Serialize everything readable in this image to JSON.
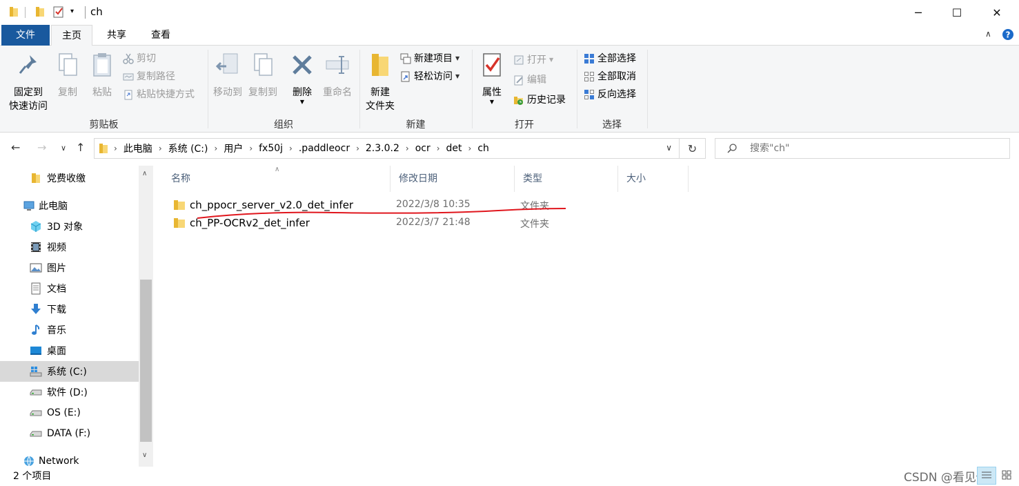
{
  "window": {
    "title": "ch",
    "controls": {
      "minimize": "─",
      "maximize": "☐",
      "close": "✕"
    }
  },
  "ribbon_tabs": {
    "file": "文件",
    "home": "主页",
    "share": "共享",
    "view": "查看"
  },
  "ribbon": {
    "clipboard": {
      "label": "剪贴板",
      "pin_line1": "固定到",
      "pin_line2": "快速访问",
      "copy": "复制",
      "paste": "粘贴",
      "cut": "剪切",
      "copy_path": "复制路径",
      "paste_shortcut": "粘贴快捷方式"
    },
    "organize": {
      "label": "组织",
      "move_to": "移动到",
      "copy_to": "复制到",
      "delete": "删除",
      "rename": "重命名"
    },
    "new": {
      "label": "新建",
      "new_folder_line1": "新建",
      "new_folder_line2": "文件夹",
      "new_item": "新建项目",
      "easy_access": "轻松访问"
    },
    "open": {
      "label": "打开",
      "properties": "属性",
      "open": "打开",
      "edit": "编辑",
      "history": "历史记录"
    },
    "select": {
      "label": "选择",
      "select_all": "全部选择",
      "select_none": "全部取消",
      "invert": "反向选择"
    }
  },
  "address": {
    "crumbs": [
      "此电脑",
      "系统 (C:)",
      "用户",
      "fx50j",
      ".paddleocr",
      "2.3.0.2",
      "ocr",
      "det",
      "ch"
    ]
  },
  "search": {
    "placeholder": "搜索\"ch\""
  },
  "nav_pane": {
    "items": [
      {
        "label": "党费收缴",
        "icon": "folder-icon",
        "level": 1
      },
      {
        "label": "此电脑",
        "icon": "computer-icon",
        "level": 0
      },
      {
        "label": "3D 对象",
        "icon": "cube-icon",
        "level": 1
      },
      {
        "label": "视频",
        "icon": "video-icon",
        "level": 1
      },
      {
        "label": "图片",
        "icon": "picture-icon",
        "level": 1
      },
      {
        "label": "文档",
        "icon": "document-icon",
        "level": 1
      },
      {
        "label": "下载",
        "icon": "download-icon",
        "level": 1
      },
      {
        "label": "音乐",
        "icon": "music-icon",
        "level": 1
      },
      {
        "label": "桌面",
        "icon": "desktop-icon",
        "level": 1
      },
      {
        "label": "系统 (C:)",
        "icon": "system-drive-icon",
        "level": 1,
        "selected": true
      },
      {
        "label": "软件 (D:)",
        "icon": "drive-icon",
        "level": 1
      },
      {
        "label": "OS (E:)",
        "icon": "drive-icon",
        "level": 1
      },
      {
        "label": "DATA (F:)",
        "icon": "drive-icon",
        "level": 1
      },
      {
        "label": "Network",
        "icon": "network-icon",
        "level": 0
      }
    ]
  },
  "file_list": {
    "columns": {
      "name": "名称",
      "modified": "修改日期",
      "type": "类型",
      "size": "大小"
    },
    "rows": [
      {
        "name": "ch_ppocr_server_v2.0_det_infer",
        "modified": "2022/3/8 10:35",
        "type": "文件夹",
        "size": ""
      },
      {
        "name": "ch_PP-OCRv2_det_infer",
        "modified": "2022/3/7 21:48",
        "type": "文件夹",
        "size": ""
      }
    ]
  },
  "status": {
    "item_count": "2 个项目"
  },
  "watermark": "CSDN @看见你",
  "colors": {
    "file_tab": "#19599e",
    "folder": "#f8d775",
    "annotation_line": "#e0161d",
    "selection": "#d9d9d9"
  }
}
